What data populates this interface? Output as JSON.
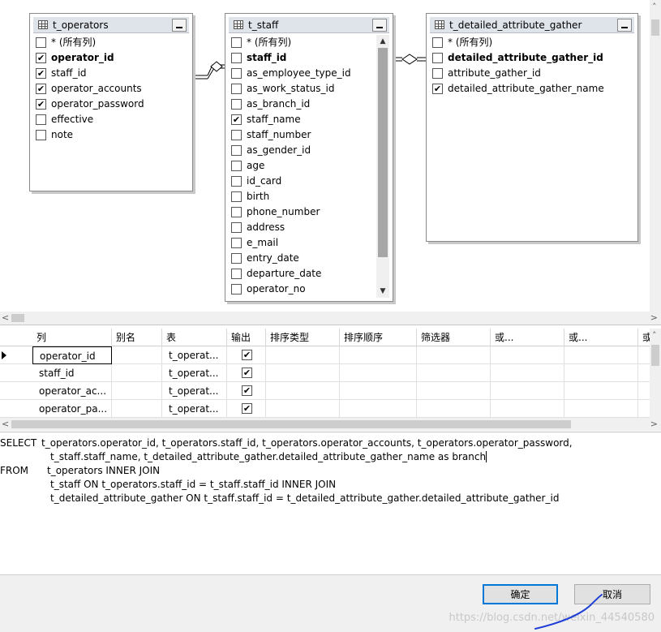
{
  "tables": [
    {
      "title": "t_operators",
      "columns": [
        {
          "name": "* (所有列)",
          "checked": false,
          "key": false
        },
        {
          "name": "operator_id",
          "checked": true,
          "key": true
        },
        {
          "name": "staff_id",
          "checked": true,
          "key": false
        },
        {
          "name": "operator_accounts",
          "checked": true,
          "key": false
        },
        {
          "name": "operator_password",
          "checked": true,
          "key": false
        },
        {
          "name": "effective",
          "checked": false,
          "key": false
        },
        {
          "name": "note",
          "checked": false,
          "key": false
        }
      ]
    },
    {
      "title": "t_staff",
      "columns": [
        {
          "name": "* (所有列)",
          "checked": false,
          "key": false
        },
        {
          "name": "staff_id",
          "checked": false,
          "key": true
        },
        {
          "name": "as_employee_type_id",
          "checked": false,
          "key": false
        },
        {
          "name": "as_work_status_id",
          "checked": false,
          "key": false
        },
        {
          "name": "as_branch_id",
          "checked": false,
          "key": false
        },
        {
          "name": "staff_name",
          "checked": true,
          "key": false
        },
        {
          "name": "staff_number",
          "checked": false,
          "key": false
        },
        {
          "name": "as_gender_id",
          "checked": false,
          "key": false
        },
        {
          "name": "age",
          "checked": false,
          "key": false
        },
        {
          "name": "id_card",
          "checked": false,
          "key": false
        },
        {
          "name": "birth",
          "checked": false,
          "key": false
        },
        {
          "name": "phone_number",
          "checked": false,
          "key": false
        },
        {
          "name": "address",
          "checked": false,
          "key": false
        },
        {
          "name": "e_mail",
          "checked": false,
          "key": false
        },
        {
          "name": "entry_date",
          "checked": false,
          "key": false
        },
        {
          "name": "departure_date",
          "checked": false,
          "key": false
        },
        {
          "name": "operator_no",
          "checked": false,
          "key": false
        }
      ]
    },
    {
      "title": "t_detailed_attribute_gather",
      "columns": [
        {
          "name": "* (所有列)",
          "checked": false,
          "key": false
        },
        {
          "name": "detailed_attribute_gather_id",
          "checked": false,
          "key": true
        },
        {
          "name": "attribute_gather_id",
          "checked": false,
          "key": false
        },
        {
          "name": "detailed_attribute_gather_name",
          "checked": true,
          "key": false
        }
      ]
    }
  ],
  "grid": {
    "headers": [
      "列",
      "别名",
      "表",
      "输出",
      "排序类型",
      "排序顺序",
      "筛选器",
      "或...",
      "或...",
      "或"
    ],
    "rows": [
      {
        "column": "operator_id",
        "alias": "",
        "table": "t_operat...",
        "output": true
      },
      {
        "column": "staff_id",
        "alias": "",
        "table": "t_operat...",
        "output": true
      },
      {
        "column": "operator_ac...",
        "alias": "",
        "table": "t_operat...",
        "output": true
      },
      {
        "column": "operator_pa...",
        "alias": "",
        "table": "t_operat...",
        "output": true
      }
    ]
  },
  "sql": {
    "lines": [
      {
        "keyword": "SELECT",
        "text": "t_operators.operator_id, t_operators.staff_id, t_operators.operator_accounts, t_operators.operator_password,"
      },
      {
        "keyword": "",
        "text": "t_staff.staff_name, t_detailed_attribute_gather.detailed_attribute_gather_name as branch"
      },
      {
        "keyword": "FROM",
        "text": "t_operators INNER JOIN"
      },
      {
        "keyword": "",
        "text": "t_staff ON t_operators.staff_id = t_staff.staff_id INNER JOIN"
      },
      {
        "keyword": "",
        "text": "t_detailed_attribute_gather ON t_staff.staff_id = t_detailed_attribute_gather.detailed_attribute_gather_id"
      }
    ]
  },
  "buttons": {
    "ok": "确定",
    "cancel": "取消"
  },
  "watermark": "https://blog.csdn.net/weixin_44540580",
  "check_glyph": "✔",
  "icons": [
    "table-icon",
    "minimize-icon",
    "check-icon",
    "row-selector-icon",
    "scroll-arrow-icon"
  ]
}
